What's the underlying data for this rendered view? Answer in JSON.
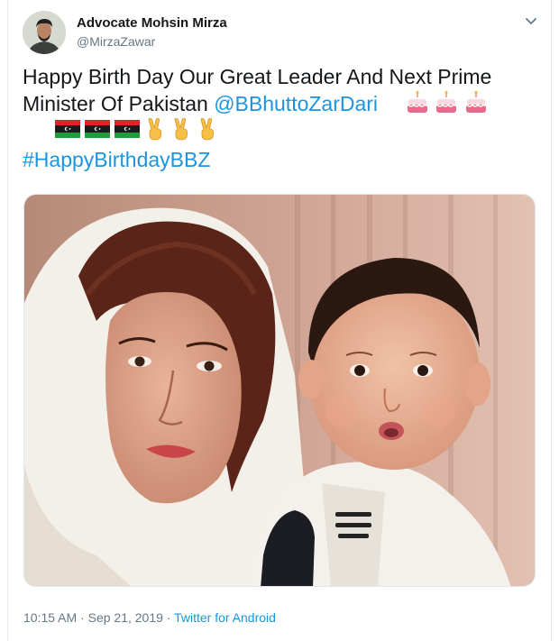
{
  "author": {
    "display_name": "Advocate Mohsin Mirza",
    "handle": "@MirzaZawar"
  },
  "tweet": {
    "text_line": "Happy Birth Day Our Great Leader And Next Prime Minister Of Pakistan",
    "mention": "@BBhuttoZarDari",
    "hashtag": "#HappyBirthdayBBZ",
    "emojis": [
      "birthday-cake",
      "birthday-cake",
      "birthday-cake",
      "ppp-flag",
      "ppp-flag",
      "ppp-flag",
      "victory-hand",
      "victory-hand",
      "victory-hand"
    ]
  },
  "footer": {
    "time": "10:15 AM",
    "separator1": "·",
    "date": "Sep 21, 2019",
    "separator2": "·",
    "source": "Twitter for Android"
  },
  "colors": {
    "link": "#1b95e0",
    "secondary_text": "#657786",
    "primary_text": "#14171a",
    "flag_black": "#1a1a1a",
    "flag_red": "#d8262a",
    "flag_green": "#1f9d3a"
  }
}
